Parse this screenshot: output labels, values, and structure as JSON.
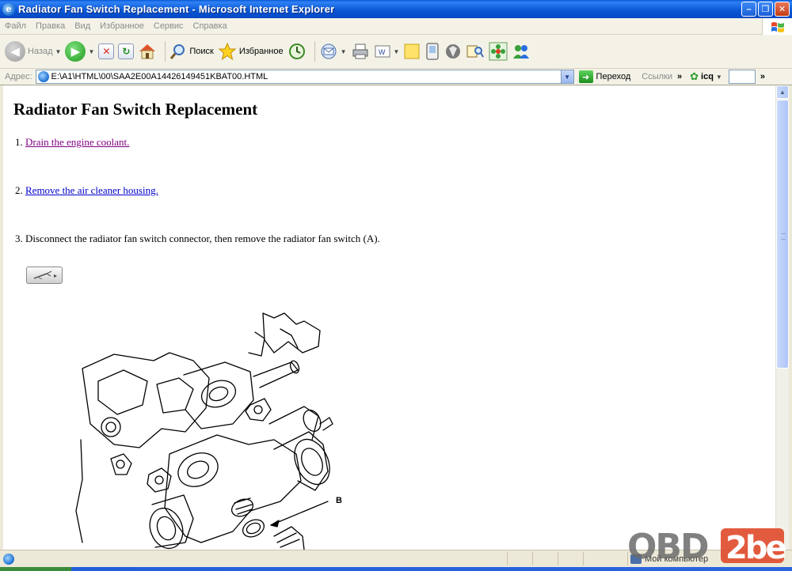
{
  "window": {
    "title": "Radiator Fan Switch Replacement - Microsoft Internet Explorer"
  },
  "menu": {
    "items": [
      "Файл",
      "Правка",
      "Вид",
      "Избранное",
      "Сервис",
      "Справка"
    ]
  },
  "toolbar": {
    "back_label": "Назад",
    "search_label": "Поиск",
    "favorites_label": "Избранное"
  },
  "address": {
    "label": "Адрес:",
    "url": "E:\\A1\\HTML\\00\\SAA2E00A14426149451KBAT00.HTML",
    "go_label": "Переход",
    "links_label": "Ссылки",
    "icq_label": "icq"
  },
  "content": {
    "title": "Radiator Fan Switch Replacement",
    "steps": [
      {
        "number": "1.",
        "text": "Drain the engine coolant.",
        "link": true,
        "visited": true
      },
      {
        "number": "2.",
        "text": "Remove the air cleaner housing.",
        "link": true,
        "visited": false
      },
      {
        "number": "3.",
        "text": "Disconnect the radiator fan switch connector, then remove the radiator fan switch (A).",
        "link": false
      }
    ],
    "diagram_callout": "B"
  },
  "status": {
    "zone_label": "Мой компьютер"
  },
  "watermark": {
    "text": "OBD2be"
  },
  "colors": {
    "titlebar": "#0b59d6",
    "visited_link": "#800080",
    "link": "#0000cc",
    "chrome": "#ece9d8"
  }
}
